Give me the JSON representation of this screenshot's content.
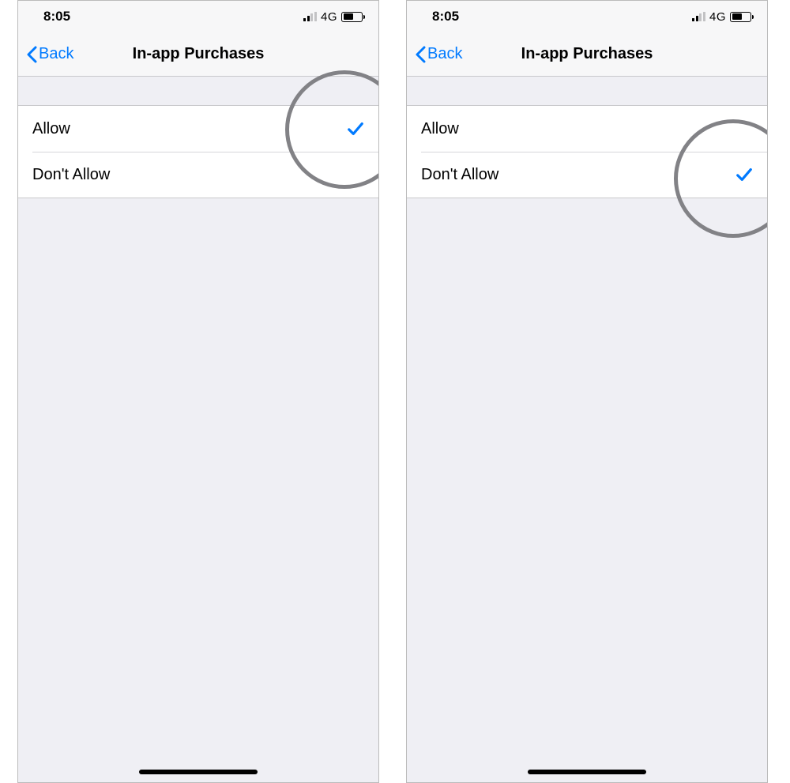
{
  "status": {
    "time": "8:05",
    "network_label": "4G"
  },
  "nav": {
    "back_label": "Back",
    "title": "In-app Purchases"
  },
  "options": {
    "allow": "Allow",
    "dont_allow": "Don't Allow"
  },
  "screens": [
    {
      "selected": "allow"
    },
    {
      "selected": "dont_allow"
    }
  ],
  "colors": {
    "ios_blue": "#007aff",
    "list_bg": "#efeff4",
    "highlight_ring": "#828286"
  }
}
